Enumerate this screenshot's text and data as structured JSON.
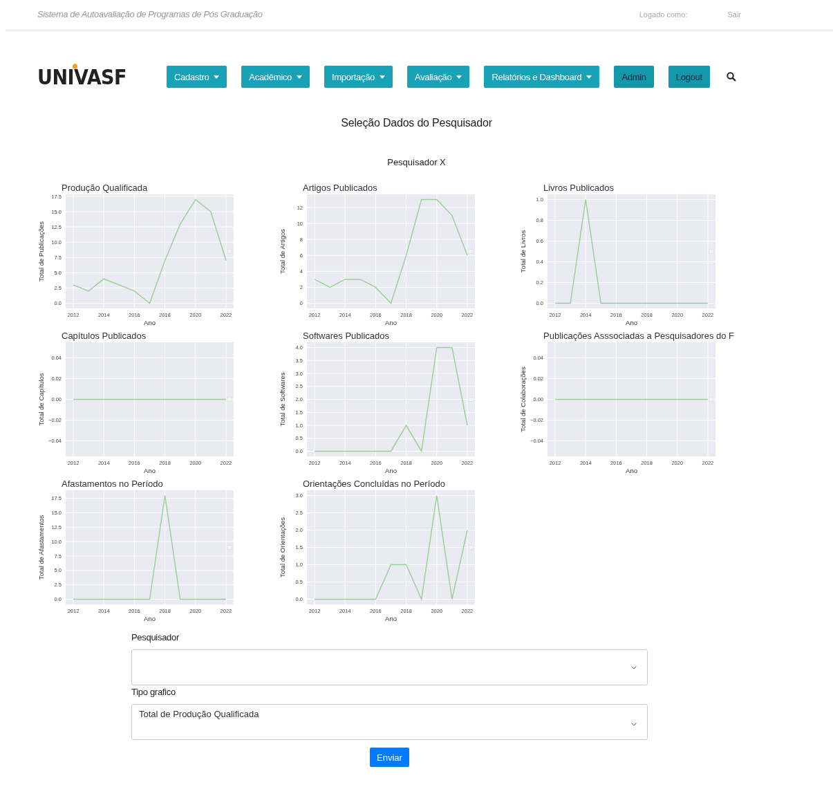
{
  "top_bar": {
    "system_name": "Sistema de Autoavaliação de Programas de Pós Graduação",
    "logged_as": "Logado como:",
    "logout": "Sair"
  },
  "logo": "UNIVASF",
  "nav": [
    {
      "label": "Cadastro",
      "kind": "dropdown"
    },
    {
      "label": "Acadêmico",
      "kind": "dropdown"
    },
    {
      "label": "Importação",
      "kind": "dropdown"
    },
    {
      "label": "Avaliação",
      "kind": "dropdown"
    },
    {
      "label": "Relatórios e Dashboard",
      "kind": "dropdown"
    },
    {
      "label": "Admin",
      "kind": "link"
    },
    {
      "label": "Logout",
      "kind": "link"
    }
  ],
  "page_title": "Seleção Dados do Pesquisador",
  "researcher": "Pesquisador X",
  "charts": [
    {
      "chart_data": {
        "type": "line",
        "title": "Produção Qualificada",
        "xlabel": "Ano",
        "ylabel": "Total de Publicações",
        "grid": true,
        "x": [
          2012,
          2013,
          2014,
          2015,
          2016,
          2017,
          2018,
          2019,
          2020,
          2021,
          2022
        ],
        "series": [
          {
            "color": "#98d395",
            "values": [
              3,
              2,
              4,
              3,
              2,
              0,
              7,
              13,
              17,
              15,
              7
            ]
          }
        ],
        "xlim": [
          2011.5,
          2022.5
        ],
        "ylim": [
          -0.85,
          17.85
        ],
        "xticks": [
          2012,
          2014,
          2016,
          2018,
          2020,
          2022
        ],
        "yticks": [
          {
            "value": 0,
            "label": "0.0"
          },
          {
            "value": 2.5,
            "label": "2.5"
          },
          {
            "value": 5,
            "label": "5.0"
          },
          {
            "value": 7.5,
            "label": "7.5"
          },
          {
            "value": 10,
            "label": "10.0"
          },
          {
            "value": 12.5,
            "label": "12.5"
          },
          {
            "value": 15,
            "label": "15.0"
          },
          {
            "value": 17.5,
            "label": "17.5"
          }
        ]
      }
    },
    {
      "chart_data": {
        "type": "line",
        "title": "Artigos Publicados",
        "xlabel": "Ano",
        "ylabel": "Total de Artigos",
        "grid": true,
        "x": [
          2012,
          2013,
          2014,
          2015,
          2016,
          2017,
          2018,
          2019,
          2020,
          2021,
          2022
        ],
        "series": [
          {
            "color": "#98d395",
            "values": [
              3,
              2,
              3,
              3,
              2,
              0,
              6,
              13,
              13,
              11,
              6
            ]
          }
        ],
        "xlim": [
          2011.5,
          2022.5
        ],
        "ylim": [
          -0.65,
          13.65
        ],
        "xticks": [
          2012,
          2014,
          2016,
          2018,
          2020,
          2022
        ],
        "yticks": [
          0,
          2,
          4,
          6,
          8,
          10,
          12
        ]
      }
    },
    {
      "chart_data": {
        "type": "line",
        "title": "Livros Publicados",
        "xlabel": "Ano",
        "ylabel": "Total de Livros",
        "grid": true,
        "x": [
          2012,
          2013,
          2014,
          2015,
          2016,
          2017,
          2018,
          2019,
          2020,
          2021,
          2022
        ],
        "series": [
          {
            "color": "#98d395",
            "values": [
              0,
              0,
              1,
              0,
              0,
              0,
              0,
              0,
              0,
              0,
              0
            ]
          }
        ],
        "xlim": [
          2011.5,
          2022.5
        ],
        "ylim": [
          -0.05,
          1.05
        ],
        "xticks": [
          2012,
          2014,
          2016,
          2018,
          2020,
          2022
        ],
        "yticks": [
          {
            "value": 0,
            "label": "0.0"
          },
          {
            "value": 0.2,
            "label": "0.2"
          },
          {
            "value": 0.4,
            "label": "0.4"
          },
          {
            "value": 0.6,
            "label": "0.6"
          },
          {
            "value": 0.8,
            "label": "0.8"
          },
          {
            "value": 1,
            "label": "1.0"
          }
        ]
      }
    },
    {
      "chart_data": {
        "type": "line",
        "title": "Capítulos Publicados",
        "xlabel": "Ano",
        "ylabel": "Total de Capítulos",
        "grid": true,
        "x": [
          2012,
          2013,
          2014,
          2015,
          2016,
          2017,
          2018,
          2019,
          2020,
          2021,
          2022
        ],
        "series": [
          {
            "color": "#98d395",
            "values": [
              0,
              0,
              0,
              0,
              0,
              0,
              0,
              0,
              0,
              0,
              0
            ]
          }
        ],
        "xlim": [
          2011.5,
          2022.5
        ],
        "ylim": [
          -0.055,
          0.055
        ],
        "xticks": [
          2012,
          2014,
          2016,
          2018,
          2020,
          2022
        ],
        "yticks": [
          {
            "value": -0.04,
            "label": "−0.04"
          },
          {
            "value": -0.02,
            "label": "−0.02"
          },
          {
            "value": 0,
            "label": "0.00"
          },
          {
            "value": 0.02,
            "label": "0.02"
          },
          {
            "value": 0.04,
            "label": "0.04"
          }
        ]
      }
    },
    {
      "chart_data": {
        "type": "line",
        "title": "Softwares Publicados",
        "xlabel": "Ano",
        "ylabel": "Total de Softwares",
        "grid": true,
        "x": [
          2012,
          2013,
          2014,
          2015,
          2016,
          2017,
          2018,
          2019,
          2020,
          2021,
          2022
        ],
        "series": [
          {
            "color": "#98d395",
            "values": [
              0,
              0,
              0,
              0,
              0,
              0,
              1,
              0,
              4,
              4,
              1
            ]
          }
        ],
        "xlim": [
          2011.5,
          2022.5
        ],
        "ylim": [
          -0.2,
          4.2
        ],
        "xticks": [
          2012,
          2014,
          2016,
          2018,
          2020,
          2022
        ],
        "yticks": [
          {
            "value": 0,
            "label": "0.0"
          },
          {
            "value": 0.5,
            "label": "0.5"
          },
          {
            "value": 1,
            "label": "1.0"
          },
          {
            "value": 1.5,
            "label": "1.5"
          },
          {
            "value": 2,
            "label": "2.0"
          },
          {
            "value": 2.5,
            "label": "2.5"
          },
          {
            "value": 3,
            "label": "3.0"
          },
          {
            "value": 3.5,
            "label": "3.5"
          },
          {
            "value": 4,
            "label": "4.0"
          }
        ]
      }
    },
    {
      "chart_data": {
        "type": "line",
        "title": "Publicações Asssociadas a Pesquisadores do F",
        "xlabel": "Ano",
        "ylabel": "Total de Colaborações",
        "grid": true,
        "x": [
          2012,
          2013,
          2014,
          2015,
          2016,
          2017,
          2018,
          2019,
          2020,
          2021,
          2022
        ],
        "series": [
          {
            "color": "#98d395",
            "values": [
              0,
              0,
              0,
              0,
              0,
              0,
              0,
              0,
              0,
              0,
              0
            ]
          }
        ],
        "xlim": [
          2011.5,
          2022.5
        ],
        "ylim": [
          -0.055,
          0.055
        ],
        "xticks": [
          2012,
          2014,
          2016,
          2018,
          2020,
          2022
        ],
        "yticks": [
          {
            "value": -0.04,
            "label": "−0.04"
          },
          {
            "value": -0.02,
            "label": "−0.02"
          },
          {
            "value": 0,
            "label": "0.00"
          },
          {
            "value": 0.02,
            "label": "0.02"
          },
          {
            "value": 0.04,
            "label": "0.04"
          }
        ]
      }
    },
    {
      "chart_data": {
        "type": "line",
        "title": "Afastamentos no Período",
        "xlabel": "Ano",
        "ylabel": "Total de Afastamentos",
        "grid": true,
        "x": [
          2012,
          2013,
          2014,
          2015,
          2016,
          2017,
          2018,
          2019,
          2020,
          2021,
          2022
        ],
        "series": [
          {
            "color": "#98d395",
            "values": [
              0,
              0,
              0,
              0,
              0,
              0,
              18,
              0,
              0,
              0,
              0
            ]
          }
        ],
        "xlim": [
          2011.5,
          2022.5
        ],
        "ylim": [
          -0.9,
          18.9
        ],
        "xticks": [
          2012,
          2014,
          2016,
          2018,
          2020,
          2022
        ],
        "yticks": [
          {
            "value": 0,
            "label": "0.0"
          },
          {
            "value": 2.5,
            "label": "2.5"
          },
          {
            "value": 5,
            "label": "5.0"
          },
          {
            "value": 7.5,
            "label": "7.5"
          },
          {
            "value": 10,
            "label": "10.0"
          },
          {
            "value": 12.5,
            "label": "12.5"
          },
          {
            "value": 15,
            "label": "15.0"
          },
          {
            "value": 17.5,
            "label": "17.5"
          }
        ]
      }
    },
    {
      "chart_data": {
        "type": "line",
        "title": "Orientações Concluídas no Período",
        "xlabel": "Ano",
        "ylabel": "Total de Orientações",
        "grid": true,
        "x": [
          2012,
          2013,
          2014,
          2015,
          2016,
          2017,
          2018,
          2019,
          2020,
          2021,
          2022
        ],
        "series": [
          {
            "color": "#98d395",
            "values": [
              0,
              0,
              0,
              0,
              0,
              1,
              1,
              0,
              3,
              0,
              2
            ]
          }
        ],
        "xlim": [
          2011.5,
          2022.5
        ],
        "ylim": [
          -0.15,
          3.15
        ],
        "xticks": [
          2012,
          2014,
          2016,
          2018,
          2020,
          2022
        ],
        "yticks": [
          {
            "value": 0,
            "label": "0.0"
          },
          {
            "value": 0.5,
            "label": "0.5"
          },
          {
            "value": 1,
            "label": "1.0"
          },
          {
            "value": 1.5,
            "label": "1.5"
          },
          {
            "value": 2,
            "label": "2.0"
          },
          {
            "value": 2.5,
            "label": "2.5"
          },
          {
            "value": 3,
            "label": "3.0"
          }
        ]
      }
    }
  ],
  "form": {
    "researcher_label": "Pesquisador",
    "chart_type_label": "Tipo grafico",
    "chart_type_value": "Total de Produção Qualificada",
    "submit": "Enviar"
  }
}
